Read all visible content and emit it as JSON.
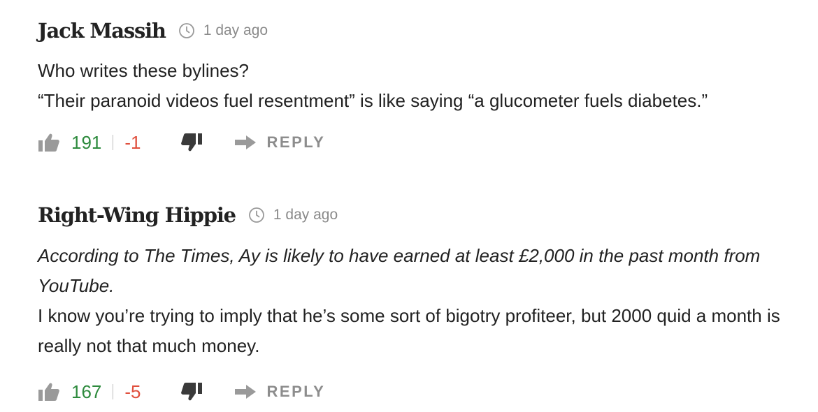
{
  "comments": [
    {
      "author": "Jack Massih",
      "timestamp": "1 day ago",
      "body": [
        "Who writes these bylines?",
        "“Their paranoid videos fuel resentment” is like saying “a glucometer fuels diabetes.”"
      ],
      "upvotes": "191",
      "downvotes": "-1",
      "reply_label": "REPLY"
    },
    {
      "author": "Right-Wing Hippie",
      "timestamp": "1 day ago",
      "quote": "According to The Times, Ay is likely to have earned at least £2,000 in the past month from YouTube.",
      "body": [
        "I know you’re trying to imply that he’s some sort of bigotry profiteer, but 2000 quid a month is really not that much money."
      ],
      "upvotes": "167",
      "downvotes": "-5",
      "reply_label": "REPLY"
    }
  ],
  "colors": {
    "upvote": "#2e8b3e",
    "downvote": "#e0503e",
    "muted": "#8a8a8a",
    "text": "#222222"
  },
  "icons": {
    "timestamp": "clock-icon",
    "upvote": "thumb-up-icon",
    "downvote": "thumb-down-icon",
    "reply": "reply-arrow-icon"
  }
}
